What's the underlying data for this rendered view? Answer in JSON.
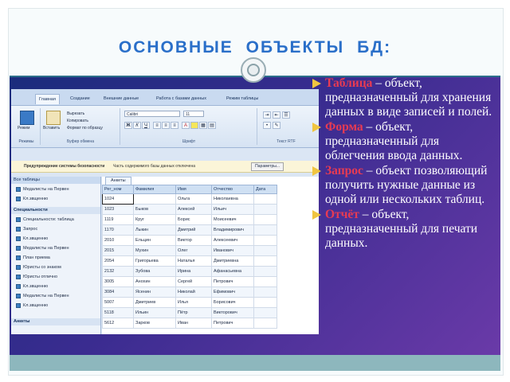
{
  "slide": {
    "title": "ОСНОВНЫЕ  ОБЪЕКТЫ  БД:",
    "bullets": [
      {
        "term": "Таблица ",
        "text": "– объект, предназначенный для хранения  данных  в виде записей и полей."
      },
      {
        "term": "Форма ",
        "text": "– объект, предназначенный для облегчения ввода данных."
      },
      {
        "term": "Запрос ",
        "text": "– объект позволяющий получить нужные данные из одной или нескольких таблиц."
      },
      {
        "term": "Отчёт ",
        "text": "– объект, предназначенный для печати данных."
      }
    ]
  },
  "access": {
    "tabs": [
      "Главная",
      "Создание",
      "Внешние данные",
      "Работа с базами данных",
      "Режим таблицы"
    ],
    "ribbon": {
      "view_label": "Режим",
      "paste_label": "Вставить",
      "cut_label": "Вырезать",
      "copy_label": "Копировать",
      "format_label": "Формат по образцу",
      "font_name": "Calibri",
      "font_size": "11",
      "groups": [
        "Режимы",
        "Буфер обмена",
        "Шрифт",
        "Текст RTF"
      ]
    },
    "security": {
      "warning": "Предупреждение системы безопасности",
      "message": "Часть содержимого базы данных отключена",
      "button": "Параметры..."
    },
    "nav": {
      "header": "Все таблицы",
      "top_items": [
        "Медалисты на Первен",
        "Кл.звщенню"
      ],
      "section": "Специальности",
      "section_items": [
        "Специальности: таблица",
        "Запрос",
        "Кл.звщенню",
        "Медалисты на Первен",
        "План приема",
        "Юристы со знаком",
        "Юристы отлично",
        "Кл.звщенню",
        "Медалисты на Первен",
        "Кл.звщенню"
      ],
      "footer": "Анкеты"
    },
    "table": {
      "doc_tab": "Анкеты",
      "columns": [
        "Рег_ном",
        "Фамилия",
        "Имя",
        "Отчество",
        "Дата"
      ],
      "rows": [
        [
          "1024",
          "",
          "Ольга",
          "Николаевна",
          ""
        ],
        [
          "1023",
          "Быков",
          "Алексей",
          "Ильич",
          ""
        ],
        [
          "1119",
          "Круг",
          "Борис",
          "Моисеевич",
          ""
        ],
        [
          "1170",
          "Лыкин",
          "Дмитрий",
          "Владимирович",
          ""
        ],
        [
          "2010",
          "Ельцин",
          "Виктор",
          "Алексеевич",
          ""
        ],
        [
          "2015",
          "Мухин",
          "Олег",
          "Иванович",
          ""
        ],
        [
          "2054",
          "Григорьева",
          "Наталья",
          "Дмитриевна",
          ""
        ],
        [
          "2132",
          "Зубова",
          "Ирина",
          "Афанасьевна",
          ""
        ],
        [
          "3005",
          "Анохин",
          "Сергей",
          "Петрович",
          ""
        ],
        [
          "3084",
          "Ясенин",
          "Николай",
          "Ефимович",
          ""
        ],
        [
          "5007",
          "Дмитриев",
          "Илья",
          "Борисович",
          ""
        ],
        [
          "5118",
          "Ильин",
          "Пётр",
          "Викторович",
          ""
        ],
        [
          "5612",
          "Зарков",
          "Иван",
          "Петрович",
          ""
        ]
      ]
    }
  }
}
